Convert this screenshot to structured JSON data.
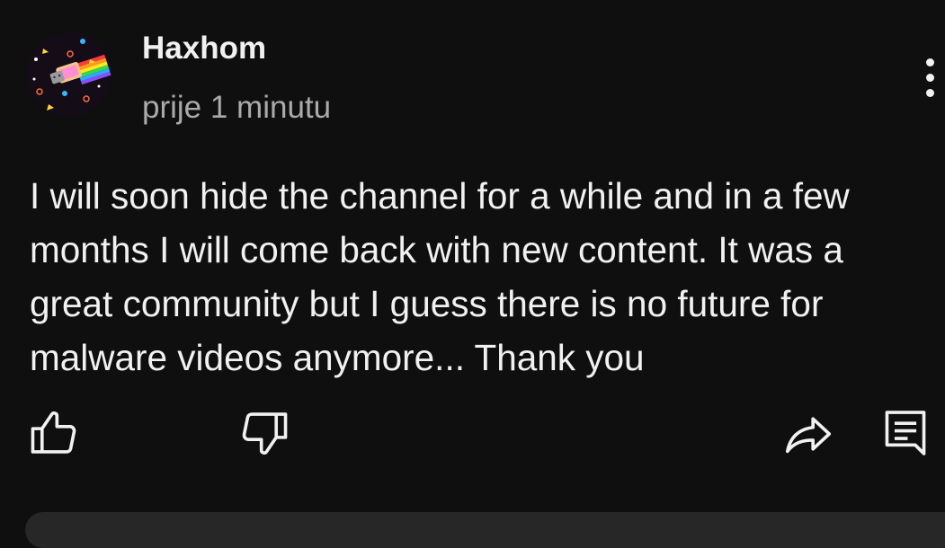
{
  "comment": {
    "author": "Haxhom",
    "timestamp": "prije 1 minutu",
    "text": "I will soon hide the channel for a while and in a few months I will come back with new content. It was a great community but I guess there is no future for malware videos anymore... Thank you"
  },
  "icons": {
    "avatar": "nyan-cat-avatar",
    "more": "more-vertical-icon",
    "like": "thumbs-up-icon",
    "dislike": "thumbs-down-icon",
    "share": "share-arrow-icon",
    "reply": "reply-comment-icon"
  },
  "colors": {
    "background": "#0f0f0f",
    "text_primary": "#f1f1f1",
    "text_secondary": "#aaaaaa",
    "input_bar": "#272727"
  }
}
